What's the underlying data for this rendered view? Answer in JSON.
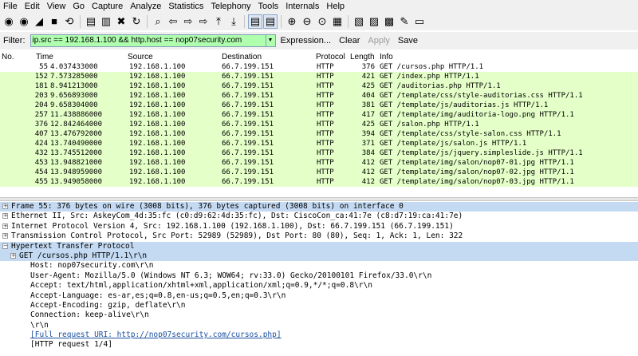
{
  "menubar": [
    "File",
    "Edit",
    "View",
    "Go",
    "Capture",
    "Analyze",
    "Statistics",
    "Telephony",
    "Tools",
    "Internals",
    "Help"
  ],
  "toolbar": [
    {
      "icon": "interface-list-icon",
      "glyph": "◉"
    },
    {
      "icon": "capture-options-icon",
      "glyph": "◉"
    },
    {
      "icon": "start-capture-icon",
      "glyph": "◢"
    },
    {
      "icon": "stop-capture-icon",
      "glyph": "■"
    },
    {
      "icon": "restart-capture-icon",
      "glyph": "⟲"
    },
    {
      "sep": true
    },
    {
      "icon": "open-file-icon",
      "glyph": "▤"
    },
    {
      "icon": "save-file-icon",
      "glyph": "▥"
    },
    {
      "icon": "close-file-icon",
      "glyph": "✖"
    },
    {
      "icon": "reload-icon",
      "glyph": "↻"
    },
    {
      "sep": true
    },
    {
      "icon": "find-packet-icon",
      "glyph": "⌕"
    },
    {
      "icon": "go-back-icon",
      "glyph": "⇦"
    },
    {
      "icon": "go-forward-icon",
      "glyph": "⇨"
    },
    {
      "icon": "go-to-packet-icon",
      "glyph": "⇨"
    },
    {
      "icon": "first-packet-icon",
      "glyph": "⤒"
    },
    {
      "icon": "last-packet-icon",
      "glyph": "⤓"
    },
    {
      "sep": true
    },
    {
      "icon": "colorize-icon",
      "glyph": "▤",
      "pressed": true
    },
    {
      "icon": "auto-scroll-icon",
      "glyph": "▤",
      "pressed": true
    },
    {
      "sep": true
    },
    {
      "icon": "zoom-in-icon",
      "glyph": "⊕"
    },
    {
      "icon": "zoom-out-icon",
      "glyph": "⊖"
    },
    {
      "icon": "normal-size-icon",
      "glyph": "⊙"
    },
    {
      "icon": "resize-columns-icon",
      "glyph": "▦"
    },
    {
      "sep": true
    },
    {
      "icon": "capture-filters-icon",
      "glyph": "▧"
    },
    {
      "icon": "display-filters-icon",
      "glyph": "▨"
    },
    {
      "icon": "coloring-rules-icon",
      "glyph": "▩"
    },
    {
      "icon": "preferences-icon",
      "glyph": "✎"
    },
    {
      "icon": "help-icon",
      "glyph": "▭"
    }
  ],
  "filter": {
    "label": "Filter:",
    "value": "ip.src == 192.168.1.100 && http.host == nop07security.com",
    "buttons": {
      "expression": "Expression...",
      "clear": "Clear",
      "apply": "Apply",
      "save": "Save"
    }
  },
  "columns": {
    "no": "No.",
    "time": "Time",
    "source": "Source",
    "destination": "Destination",
    "protocol": "Protocol",
    "length": "Length",
    "info": "Info"
  },
  "packets": [
    {
      "no": "55",
      "time": "4.037433000",
      "src": "192.168.1.100",
      "dst": "66.7.199.151",
      "proto": "HTTP",
      "len": "376",
      "info": "GET /cursos.php HTTP/1.1",
      "selected": true
    },
    {
      "no": "152",
      "time": "7.573285000",
      "src": "192.168.1.100",
      "dst": "66.7.199.151",
      "proto": "HTTP",
      "len": "421",
      "info": "GET /index.php HTTP/1.1"
    },
    {
      "no": "181",
      "time": "8.941213000",
      "src": "192.168.1.100",
      "dst": "66.7.199.151",
      "proto": "HTTP",
      "len": "425",
      "info": "GET /auditorias.php HTTP/1.1"
    },
    {
      "no": "203",
      "time": "9.656893000",
      "src": "192.168.1.100",
      "dst": "66.7.199.151",
      "proto": "HTTP",
      "len": "404",
      "info": "GET /template/css/style-auditorias.css HTTP/1.1"
    },
    {
      "no": "204",
      "time": "9.658304000",
      "src": "192.168.1.100",
      "dst": "66.7.199.151",
      "proto": "HTTP",
      "len": "381",
      "info": "GET /template/js/auditorias.js HTTP/1.1"
    },
    {
      "no": "257",
      "time": "11.438886000",
      "src": "192.168.1.100",
      "dst": "66.7.199.151",
      "proto": "HTTP",
      "len": "417",
      "info": "GET /template/img/auditoria-logo.png HTTP/1.1"
    },
    {
      "no": "376",
      "time": "12.842464000",
      "src": "192.168.1.100",
      "dst": "66.7.199.151",
      "proto": "HTTP",
      "len": "425",
      "info": "GET /salon.php HTTP/1.1"
    },
    {
      "no": "407",
      "time": "13.476792000",
      "src": "192.168.1.100",
      "dst": "66.7.199.151",
      "proto": "HTTP",
      "len": "394",
      "info": "GET /template/css/style-salon.css HTTP/1.1"
    },
    {
      "no": "424",
      "time": "13.740490000",
      "src": "192.168.1.100",
      "dst": "66.7.199.151",
      "proto": "HTTP",
      "len": "371",
      "info": "GET /template/js/salon.js HTTP/1.1"
    },
    {
      "no": "432",
      "time": "13.745512000",
      "src": "192.168.1.100",
      "dst": "66.7.199.151",
      "proto": "HTTP",
      "len": "384",
      "info": "GET /template/js/jquery.simpleslide.js HTTP/1.1"
    },
    {
      "no": "453",
      "time": "13.948821000",
      "src": "192.168.1.100",
      "dst": "66.7.199.151",
      "proto": "HTTP",
      "len": "412",
      "info": "GET /template/img/salon/nop07-01.jpg HTTP/1.1"
    },
    {
      "no": "454",
      "time": "13.948959000",
      "src": "192.168.1.100",
      "dst": "66.7.199.151",
      "proto": "HTTP",
      "len": "412",
      "info": "GET /template/img/salon/nop07-02.jpg HTTP/1.1"
    },
    {
      "no": "455",
      "time": "13.949058000",
      "src": "192.168.1.100",
      "dst": "66.7.199.151",
      "proto": "HTTP",
      "len": "412",
      "info": "GET /template/img/salon/nop07-03.jpg HTTP/1.1"
    }
  ],
  "details": [
    {
      "indent": 0,
      "exp": "+",
      "text": "Frame 55: 376 bytes on wire (3008 bits), 376 bytes captured (3008 bits) on interface 0",
      "sel": true
    },
    {
      "indent": 0,
      "exp": "+",
      "text": "Ethernet II, Src: AskeyCom_4d:35:fc (c0:d9:62:4d:35:fc), Dst: CiscoCon_ca:41:7e (c8:d7:19:ca:41:7e)"
    },
    {
      "indent": 0,
      "exp": "+",
      "text": "Internet Protocol Version 4, Src: 192.168.1.100 (192.168.1.100), Dst: 66.7.199.151 (66.7.199.151)"
    },
    {
      "indent": 0,
      "exp": "+",
      "text": "Transmission Control Protocol, Src Port: 52989 (52989), Dst Port: 80 (80), Seq: 1, Ack: 1, Len: 322"
    },
    {
      "indent": 0,
      "exp": "−",
      "text": "Hypertext Transfer Protocol",
      "sel": true
    },
    {
      "indent": 1,
      "exp": "+",
      "text": "GET /cursos.php HTTP/1.1\\r\\n",
      "sel": true
    },
    {
      "indent": 2,
      "text": "Host: nop07security.com\\r\\n"
    },
    {
      "indent": 2,
      "text": "User-Agent: Mozilla/5.0 (Windows NT 6.3; WOW64; rv:33.0) Gecko/20100101 Firefox/33.0\\r\\n"
    },
    {
      "indent": 2,
      "text": "Accept: text/html,application/xhtml+xml,application/xml;q=0.9,*/*;q=0.8\\r\\n"
    },
    {
      "indent": 2,
      "text": "Accept-Language: es-ar,es;q=0.8,en-us;q=0.5,en;q=0.3\\r\\n"
    },
    {
      "indent": 2,
      "text": "Accept-Encoding: gzip, deflate\\r\\n"
    },
    {
      "indent": 2,
      "text": "Connection: keep-alive\\r\\n"
    },
    {
      "indent": 2,
      "text": "\\r\\n"
    },
    {
      "indent": 2,
      "text": "[Full request URI: http://nop07security.com/cursos.php]",
      "link": true
    },
    {
      "indent": 2,
      "text": "[HTTP request 1/4]"
    }
  ]
}
